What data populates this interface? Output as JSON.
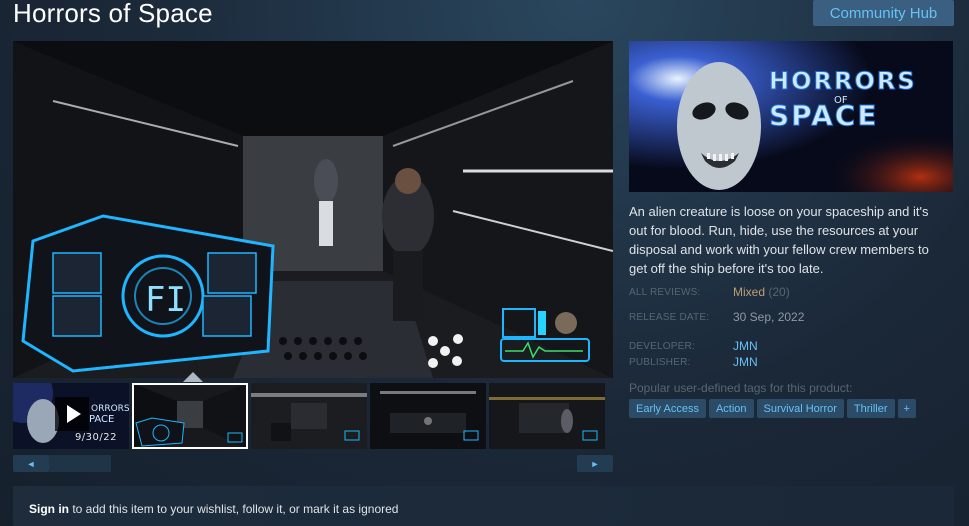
{
  "app": {
    "title": "Horrors of Space",
    "community_hub_label": "Community Hub"
  },
  "capsule": {
    "logo_line1": "HORRORS",
    "logo_of": "OF",
    "logo_line2": "SPACE"
  },
  "media": {
    "thumbnails": [
      {
        "type": "video",
        "date_text": "9/30/22"
      },
      {
        "type": "screenshot",
        "selected": true
      },
      {
        "type": "screenshot"
      },
      {
        "type": "screenshot"
      },
      {
        "type": "screenshot"
      }
    ],
    "scroll_left_icon": "◄",
    "scroll_right_icon": "►"
  },
  "description": "An alien creature is loose on your spaceship and it's out for blood. Run, hide, use the resources at your disposal and work with your fellow crew members to get off the ship before it's too late.",
  "reviews": {
    "label": "ALL REVIEWS:",
    "summary": "Mixed",
    "count": "(20)"
  },
  "release": {
    "label": "RELEASE DATE:",
    "date": "30 Sep, 2022"
  },
  "developer": {
    "label": "DEVELOPER:",
    "name": "JMN"
  },
  "publisher": {
    "label": "PUBLISHER:",
    "name": "JMN"
  },
  "tags": {
    "heading": "Popular user-defined tags for this product:",
    "items": [
      "Early Access",
      "Action",
      "Survival Horror",
      "Thriller"
    ],
    "more_label": "+"
  },
  "signin": {
    "link_label": "Sign in",
    "rest_text": " to add this item to your wishlist, follow it, or mark it as ignored"
  },
  "colors": {
    "background": "#1b2838",
    "link": "#67c1f5",
    "mixed_review": "#b9a074",
    "tag_bg": "#2b4b66"
  }
}
